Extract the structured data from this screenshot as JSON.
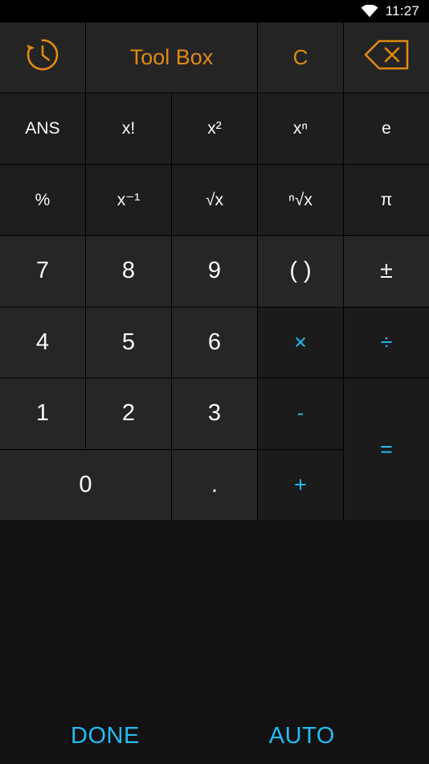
{
  "statusbar": {
    "wifi_icon": "wifi-icon",
    "time": "11:27"
  },
  "theme": {
    "accent_orange": "#E08A12",
    "accent_cyan": "#22BDF2",
    "key_bg": "#262626",
    "operator_bg": "#1b1b1b",
    "function_bg": "#1e1e1e",
    "panel_bg": "#121212",
    "text_color": "#fafafa"
  },
  "header": {
    "history_icon": "history-clock-icon",
    "toolbox_label": "Tool Box",
    "clear_label": "C",
    "backspace_icon": "backspace-icon"
  },
  "functions": {
    "row1": [
      {
        "label": "ANS",
        "name": "key-ans"
      },
      {
        "label": "x!",
        "name": "key-factorial"
      },
      {
        "label": "x²",
        "name": "key-square"
      },
      {
        "label": "xⁿ",
        "name": "key-power-n"
      },
      {
        "label": "e",
        "name": "key-euler"
      }
    ],
    "row2": [
      {
        "label": "%",
        "name": "key-percent"
      },
      {
        "label": "x⁻¹",
        "name": "key-reciprocal"
      },
      {
        "label": "√x",
        "name": "key-sqrt"
      },
      {
        "label": "ⁿ√x",
        "name": "key-nth-root"
      },
      {
        "label": "π",
        "name": "key-pi"
      }
    ]
  },
  "keypad": {
    "seven": "7",
    "eight": "8",
    "nine": "9",
    "parentheses": "( )",
    "plusminus": "±",
    "four": "4",
    "five": "5",
    "six": "6",
    "multiply": "×",
    "divide": "÷",
    "one": "1",
    "two": "2",
    "three": "3",
    "minus": "-",
    "equals": "=",
    "zero": "0",
    "decimal": ".",
    "plus": "+"
  },
  "actions": {
    "done_label": "DONE",
    "auto_label": "AUTO"
  }
}
